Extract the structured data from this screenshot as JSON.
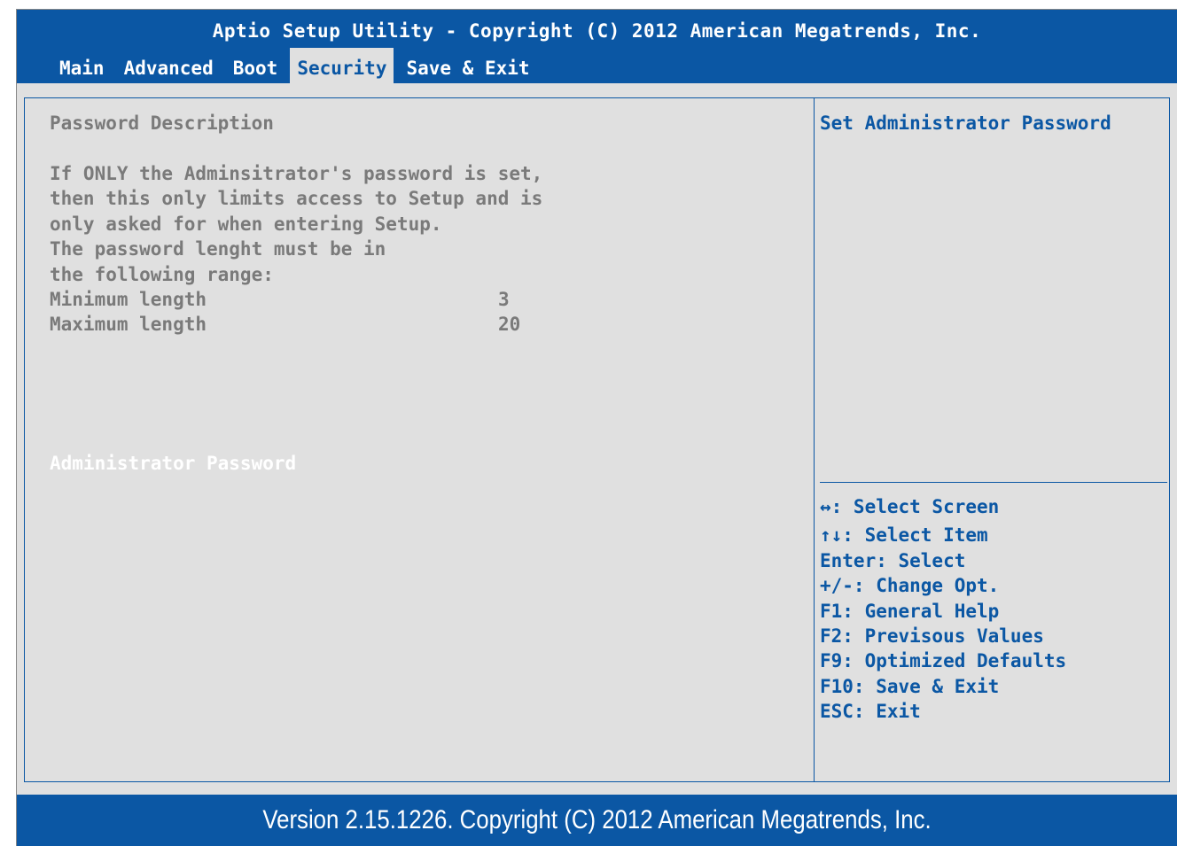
{
  "header": {
    "title": "Aptio Setup Utility - Copyright (C) 2012 American Megatrends, Inc.",
    "tabs": [
      {
        "label": "Main"
      },
      {
        "label": "Advanced"
      },
      {
        "label": "Boot"
      },
      {
        "label": "Security"
      },
      {
        "label": "Save & Exit"
      }
    ],
    "active_tab": "Security"
  },
  "main": {
    "section_title": "Password Description",
    "description_lines": [
      "If ONLY the Adminsitrator's password is set,",
      "then this only limits access to Setup and is",
      "only asked for when entering Setup.",
      "The password lenght must be in",
      "the following range:"
    ],
    "min_label": "Minimum length",
    "min_value": "3",
    "max_label": "Maximum length",
    "max_value": "20",
    "admin_password_item": "Administrator Password"
  },
  "help": {
    "title": "Set Administrator Password",
    "keys": [
      "↔: Select Screen",
      "↑↓: Select Item",
      "Enter: Select",
      "+/-: Change Opt.",
      "F1: General Help",
      "F2: Previsous Values",
      "F9: Optimized Defaults",
      "F10: Save & Exit",
      "ESC: Exit"
    ]
  },
  "footer": {
    "text": "Version 2.15.1226. Copyright (C) 2012 American Megatrends, Inc."
  },
  "colors": {
    "accent": "#0b57a4",
    "background": "#e0e0e0",
    "text_dim": "#7a7a7a",
    "text_highlight": "#ffffff"
  }
}
